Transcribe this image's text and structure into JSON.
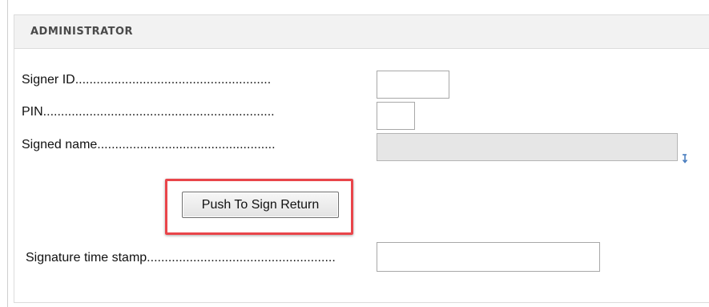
{
  "panel": {
    "title": "ADMINISTRATOR"
  },
  "form": {
    "signer_id": {
      "label": "Signer ID.......................................................",
      "value": ""
    },
    "pin": {
      "label": "PIN.................................................................",
      "value": ""
    },
    "signed_name": {
      "label": "Signed name..................................................",
      "value": "",
      "picker_icon": "arrow-down-icon"
    },
    "push_button_label": "Push To Sign Return",
    "signature_time_stamp": {
      "label": "Signature time stamp.....................................................",
      "value": ""
    }
  },
  "colors": {
    "highlight": "#e9454a",
    "header_bg": "#f2f2f2",
    "readonly_field_bg": "#e6e6e6",
    "picker_icon": "#4a7ebf"
  }
}
